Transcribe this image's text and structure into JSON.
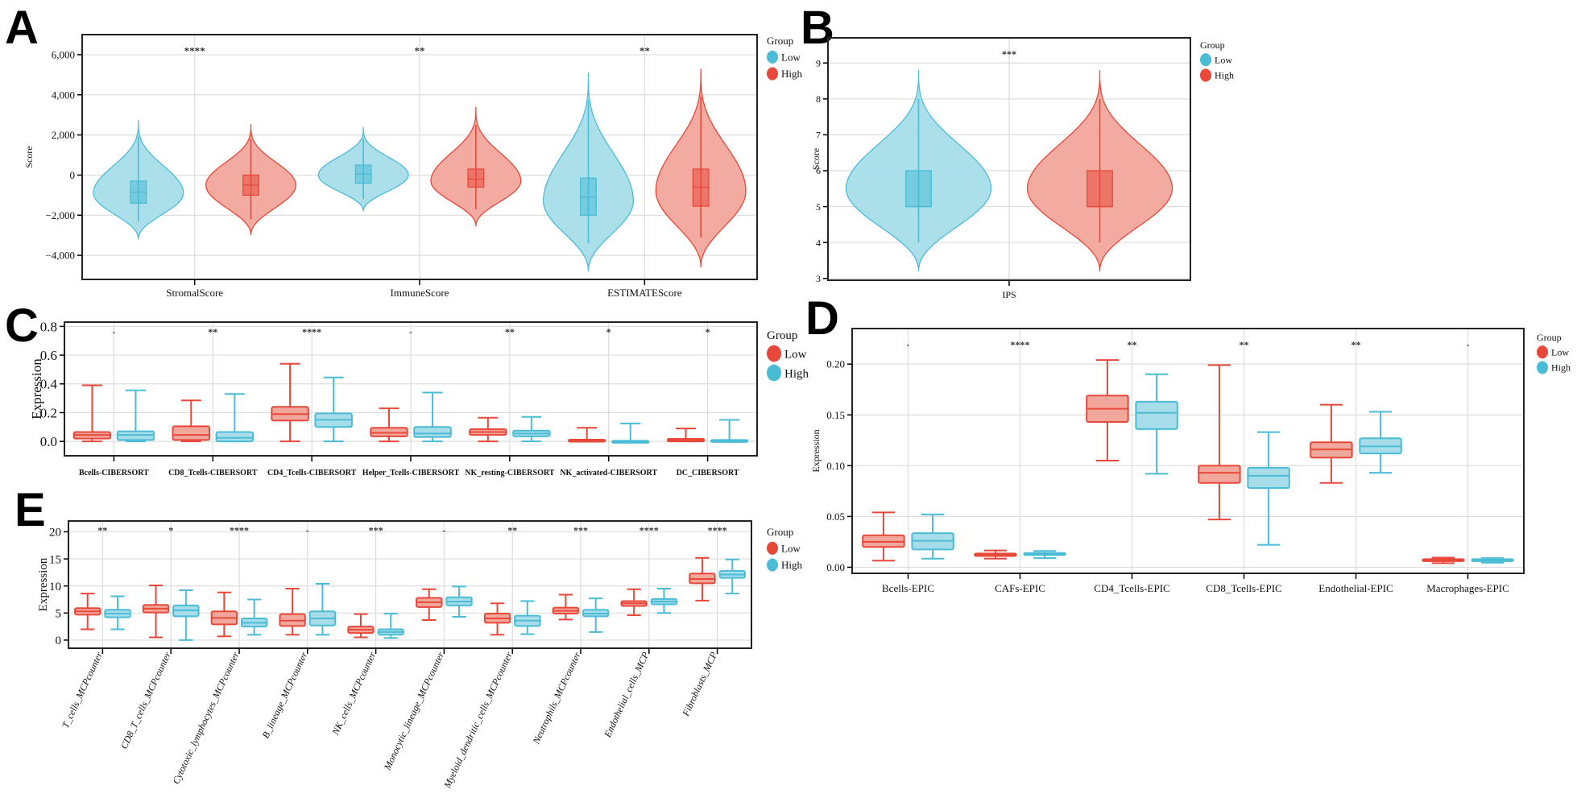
{
  "colors": {
    "low_blue": "#4bbcd6",
    "high_red": "#e8483a",
    "blue_fill": "#a6dde9",
    "red_fill": "#f2a79c",
    "grid": "#dddddd"
  },
  "chart_data": [
    {
      "id": "A",
      "panel_letter": "A",
      "type": "violin",
      "title": "",
      "xlabel": "",
      "ylabel": "Score",
      "ylim": [
        -5200,
        7000
      ],
      "yticks": [
        -4000,
        -2000,
        0,
        2000,
        4000,
        6000
      ],
      "ytick_labels": [
        "−4,000",
        "−2,000",
        "0",
        "2,000",
        "4,000",
        "6,000"
      ],
      "grid": true,
      "legend": {
        "title": "Group",
        "placement": "right",
        "entries": [
          {
            "label": "Low",
            "color": "#4bbcd6"
          },
          {
            "label": "High",
            "color": "#e8483a"
          }
        ]
      },
      "categories": [
        "StromalScore",
        "ImmuneScore",
        "ESTIMATEScore"
      ],
      "significance": [
        "****",
        "**",
        "**"
      ],
      "series": [
        {
          "name": "Low",
          "color": "#4bbcd6",
          "values": [
            {
              "min": -3200,
              "q1": -1400,
              "median": -850,
              "q3": -300,
              "max": 2750,
              "whisk_lo": -2300,
              "whisk_hi": 1900,
              "mode": -900,
              "spread": 1.0
            },
            {
              "min": -1800,
              "q1": -400,
              "median": 50,
              "q3": 500,
              "max": 2400,
              "whisk_lo": -1200,
              "whisk_hi": 1800,
              "mode": 0,
              "spread": 1.0
            },
            {
              "min": -4800,
              "q1": -2000,
              "median": -1100,
              "q3": -150,
              "max": 5100,
              "whisk_lo": -3400,
              "whisk_hi": 3700,
              "mode": -1300,
              "spread": 1.0
            }
          ]
        },
        {
          "name": "High",
          "color": "#e8483a",
          "values": [
            {
              "min": -3000,
              "q1": -1000,
              "median": -500,
              "q3": 0,
              "max": 2550,
              "whisk_lo": -2200,
              "whisk_hi": 1800,
              "mode": -500,
              "spread": 1.0
            },
            {
              "min": -2550,
              "q1": -600,
              "median": -200,
              "q3": 300,
              "max": 3400,
              "whisk_lo": -1700,
              "whisk_hi": 2500,
              "mode": -300,
              "spread": 1.0
            },
            {
              "min": -4600,
              "q1": -1550,
              "median": -600,
              "q3": 300,
              "max": 5300,
              "whisk_lo": -3100,
              "whisk_hi": 3900,
              "mode": -800,
              "spread": 1.0
            }
          ]
        }
      ]
    },
    {
      "id": "B",
      "panel_letter": "B",
      "type": "violin",
      "title": "",
      "xlabel": "",
      "ylabel": "Score",
      "ylim": [
        2.95,
        9.7
      ],
      "yticks": [
        3,
        4,
        5,
        6,
        7,
        8,
        9
      ],
      "ytick_labels": [
        "3",
        "4",
        "5",
        "6",
        "7",
        "8",
        "9"
      ],
      "grid": true,
      "legend": {
        "title": "Group",
        "placement": "right",
        "entries": [
          {
            "label": "Low",
            "color": "#4bbcd6"
          },
          {
            "label": "High",
            "color": "#e8483a"
          }
        ]
      },
      "categories": [
        "IPS"
      ],
      "significance": [
        "***"
      ],
      "series": [
        {
          "name": "Low",
          "color": "#4bbcd6",
          "values": [
            {
              "min": 3.2,
              "q1": 5,
              "median": 5,
              "q3": 6,
              "max": 8.8,
              "whisk_lo": 4,
              "whisk_hi": 8,
              "mode": 5.5,
              "spread": 1.0
            }
          ]
        },
        {
          "name": "High",
          "color": "#e8483a",
          "values": [
            {
              "min": 3.2,
              "q1": 5,
              "median": 5,
              "q3": 6,
              "max": 8.8,
              "whisk_lo": 4,
              "whisk_hi": 8,
              "mode": 5.5,
              "spread": 1.0
            }
          ]
        }
      ]
    },
    {
      "id": "C",
      "panel_letter": "C",
      "type": "box",
      "title": "",
      "xlabel": "",
      "ylabel": "Expression",
      "ylim": [
        -0.1,
        0.83
      ],
      "yticks": [
        0.0,
        0.2,
        0.4,
        0.6,
        0.8
      ],
      "ytick_labels": [
        "0.0",
        "0.2",
        "0.4",
        "0.6",
        "0.8"
      ],
      "grid": true,
      "legend": {
        "title": "Group",
        "placement": "right",
        "entries": [
          {
            "label": "Low",
            "color": "#e8483a"
          },
          {
            "label": "High",
            "color": "#4bbcd6"
          }
        ]
      },
      "categories": [
        "Bcells-CIBERSORT",
        "CD8_Tcells-CIBERSORT",
        "CD4_Tcells-CIBERSORT",
        "Helper_Tcells-CIBERSORT",
        "NK_resting-CIBERSORT",
        "NK_activated-CIBERSORT",
        "DC_CIBERSORT"
      ],
      "significance": [
        "-",
        "**",
        "****",
        "-",
        "**",
        "*",
        "*"
      ],
      "series": [
        {
          "name": "Low",
          "color": "#e8483a",
          "values": [
            {
              "whisk_lo": 0,
              "q1": 0.02,
              "median": 0.045,
              "q3": 0.065,
              "whisk_hi": 0.39
            },
            {
              "whisk_lo": 0,
              "q1": 0.01,
              "median": 0.045,
              "q3": 0.105,
              "whisk_hi": 0.285
            },
            {
              "whisk_lo": 0,
              "q1": 0.145,
              "median": 0.19,
              "q3": 0.24,
              "whisk_hi": 0.54
            },
            {
              "whisk_lo": 0,
              "q1": 0.035,
              "median": 0.06,
              "q3": 0.095,
              "whisk_hi": 0.23
            },
            {
              "whisk_lo": 0,
              "q1": 0.045,
              "median": 0.065,
              "q3": 0.085,
              "whisk_hi": 0.165
            },
            {
              "whisk_lo": 0,
              "q1": 0,
              "median": 0.005,
              "q3": 0.012,
              "whisk_hi": 0.095
            },
            {
              "whisk_lo": 0,
              "q1": 0,
              "median": 0.008,
              "q3": 0.018,
              "whisk_hi": 0.09
            }
          ]
        },
        {
          "name": "High",
          "color": "#4bbcd6",
          "values": [
            {
              "whisk_lo": 0,
              "q1": 0.01,
              "median": 0.045,
              "q3": 0.07,
              "whisk_hi": 0.355
            },
            {
              "whisk_lo": 0,
              "q1": 0,
              "median": 0.025,
              "q3": 0.065,
              "whisk_hi": 0.33
            },
            {
              "whisk_lo": 0,
              "q1": 0.1,
              "median": 0.15,
              "q3": 0.195,
              "whisk_hi": 0.445
            },
            {
              "whisk_lo": 0,
              "q1": 0.03,
              "median": 0.055,
              "q3": 0.1,
              "whisk_hi": 0.34
            },
            {
              "whisk_lo": 0,
              "q1": 0.035,
              "median": 0.055,
              "q3": 0.075,
              "whisk_hi": 0.17
            },
            {
              "whisk_lo": 0,
              "q1": 0,
              "median": 0,
              "q3": 0.004,
              "whisk_hi": 0.125
            },
            {
              "whisk_lo": 0,
              "q1": 0,
              "median": 0.003,
              "q3": 0.01,
              "whisk_hi": 0.15
            }
          ]
        }
      ]
    },
    {
      "id": "D",
      "panel_letter": "D",
      "type": "box",
      "title": "",
      "xlabel": "",
      "ylabel": "Expression",
      "ylim": [
        -0.006,
        0.235
      ],
      "yticks": [
        0.0,
        0.05,
        0.1,
        0.15,
        0.2
      ],
      "ytick_labels": [
        "0.00",
        "0.05",
        "0.10",
        "0.15",
        "0.20"
      ],
      "grid": true,
      "legend": {
        "title": "Group",
        "placement": "right",
        "entries": [
          {
            "label": "Low",
            "color": "#e8483a"
          },
          {
            "label": "High",
            "color": "#4bbcd6"
          }
        ]
      },
      "categories": [
        "Bcells-EPIC",
        "CAFs-EPIC",
        "CD4_Tcells-EPIC",
        "CD8_Tcells-EPIC",
        "Endothelial-EPIC",
        "Macrophages-EPIC"
      ],
      "significance": [
        "-",
        "****",
        "**",
        "**",
        "**",
        "-"
      ],
      "series": [
        {
          "name": "Low",
          "color": "#e8483a",
          "values": [
            {
              "whisk_lo": 0.0065,
              "q1": 0.02,
              "median": 0.025,
              "q3": 0.0315,
              "whisk_hi": 0.054
            },
            {
              "whisk_lo": 0.0085,
              "q1": 0.011,
              "median": 0.0125,
              "q3": 0.0135,
              "whisk_hi": 0.0165
            },
            {
              "whisk_lo": 0.105,
              "q1": 0.143,
              "median": 0.156,
              "q3": 0.169,
              "whisk_hi": 0.204
            },
            {
              "whisk_lo": 0.047,
              "q1": 0.083,
              "median": 0.093,
              "q3": 0.1,
              "whisk_hi": 0.199
            },
            {
              "whisk_lo": 0.083,
              "q1": 0.108,
              "median": 0.116,
              "q3": 0.123,
              "whisk_hi": 0.16
            },
            {
              "whisk_lo": 0.004,
              "q1": 0.0065,
              "median": 0.007,
              "q3": 0.008,
              "whisk_hi": 0.0095
            }
          ]
        },
        {
          "name": "High",
          "color": "#4bbcd6",
          "values": [
            {
              "whisk_lo": 0.0085,
              "q1": 0.0175,
              "median": 0.026,
              "q3": 0.0335,
              "whisk_hi": 0.052
            },
            {
              "whisk_lo": 0.009,
              "q1": 0.012,
              "median": 0.013,
              "q3": 0.014,
              "whisk_hi": 0.016
            },
            {
              "whisk_lo": 0.092,
              "q1": 0.136,
              "median": 0.152,
              "q3": 0.163,
              "whisk_hi": 0.19
            },
            {
              "whisk_lo": 0.022,
              "q1": 0.078,
              "median": 0.09,
              "q3": 0.098,
              "whisk_hi": 0.133
            },
            {
              "whisk_lo": 0.093,
              "q1": 0.112,
              "median": 0.119,
              "q3": 0.127,
              "whisk_hi": 0.153
            },
            {
              "whisk_lo": 0.0045,
              "q1": 0.0065,
              "median": 0.007,
              "q3": 0.008,
              "whisk_hi": 0.009
            }
          ]
        }
      ]
    },
    {
      "id": "E",
      "panel_letter": "E",
      "type": "box",
      "title": "",
      "xlabel": "",
      "ylabel": "Expression",
      "ylim": [
        -1.5,
        22
      ],
      "yticks": [
        0,
        5,
        10,
        15,
        20
      ],
      "ytick_labels": [
        "0",
        "5",
        "10",
        "15",
        "20"
      ],
      "grid": true,
      "legend": {
        "title": "Group",
        "placement": "right",
        "entries": [
          {
            "label": "Low",
            "color": "#e8483a"
          },
          {
            "label": "High",
            "color": "#4bbcd6"
          }
        ]
      },
      "categories": [
        "T_cells_MCPcounter",
        "CD8_T_cells_MCPcounter",
        "Cytotoxic_lymphocytes_MCPcounter",
        "B_lineage_MCPcounter",
        "NK_cells_MCPcounter",
        "Monocytic_lineage_MCPcounter",
        "Myeloid_dendritic_cells_MCPcounter",
        "Neutrophils_MCPcounter",
        "Endothelial_cells_MCP",
        "Fibroblasts_MCP"
      ],
      "significance": [
        "**",
        "*",
        "****",
        "-",
        "***",
        "-",
        "**",
        "***",
        "****",
        "****"
      ],
      "series": [
        {
          "name": "Low",
          "color": "#e8483a",
          "values": [
            {
              "whisk_lo": 2.0,
              "q1": 4.7,
              "median": 5.3,
              "q3": 5.9,
              "whisk_hi": 8.6
            },
            {
              "whisk_lo": 0.5,
              "q1": 5.1,
              "median": 5.8,
              "q3": 6.5,
              "whisk_hi": 10.1
            },
            {
              "whisk_lo": 0.7,
              "q1": 2.9,
              "median": 4.1,
              "q3": 5.3,
              "whisk_hi": 8.8
            },
            {
              "whisk_lo": 1.0,
              "q1": 2.6,
              "median": 3.6,
              "q3": 4.8,
              "whisk_hi": 9.5
            },
            {
              "whisk_lo": 0.5,
              "q1": 1.3,
              "median": 1.9,
              "q3": 2.5,
              "whisk_hi": 4.8
            },
            {
              "whisk_lo": 3.7,
              "q1": 6.1,
              "median": 7.0,
              "q3": 7.8,
              "whisk_hi": 9.4
            },
            {
              "whisk_lo": 1.0,
              "q1": 3.2,
              "median": 4.0,
              "q3": 4.9,
              "whisk_hi": 6.8
            },
            {
              "whisk_lo": 3.8,
              "q1": 4.9,
              "median": 5.4,
              "q3": 6.0,
              "whisk_hi": 8.4
            },
            {
              "whisk_lo": 4.6,
              "q1": 6.3,
              "median": 6.8,
              "q3": 7.2,
              "whisk_hi": 9.4
            },
            {
              "whisk_lo": 7.3,
              "q1": 10.5,
              "median": 11.3,
              "q3": 12.3,
              "whisk_hi": 15.2
            }
          ]
        },
        {
          "name": "High",
          "color": "#4bbcd6",
          "values": [
            {
              "whisk_lo": 2.0,
              "q1": 4.2,
              "median": 4.9,
              "q3": 5.6,
              "whisk_hi": 8.1
            },
            {
              "whisk_lo": 0.0,
              "q1": 4.4,
              "median": 5.5,
              "q3": 6.4,
              "whisk_hi": 9.2
            },
            {
              "whisk_lo": 1.0,
              "q1": 2.5,
              "median": 3.2,
              "q3": 4.0,
              "whisk_hi": 7.5
            },
            {
              "whisk_lo": 1.0,
              "q1": 2.7,
              "median": 4.0,
              "q3": 5.3,
              "whisk_hi": 10.4
            },
            {
              "whisk_lo": 0.4,
              "q1": 1.0,
              "median": 1.5,
              "q3": 2.0,
              "whisk_hi": 4.9
            },
            {
              "whisk_lo": 4.3,
              "q1": 6.4,
              "median": 7.1,
              "q3": 7.9,
              "whisk_hi": 9.9
            },
            {
              "whisk_lo": 1.1,
              "q1": 2.6,
              "median": 3.6,
              "q3": 4.5,
              "whisk_hi": 7.2
            },
            {
              "whisk_lo": 1.5,
              "q1": 4.4,
              "median": 4.9,
              "q3": 5.6,
              "whisk_hi": 7.7
            },
            {
              "whisk_lo": 5.0,
              "q1": 6.6,
              "median": 7.1,
              "q3": 7.6,
              "whisk_hi": 9.5
            },
            {
              "whisk_lo": 8.6,
              "q1": 11.5,
              "median": 12.1,
              "q3": 12.8,
              "whisk_hi": 14.9
            }
          ]
        }
      ]
    }
  ]
}
